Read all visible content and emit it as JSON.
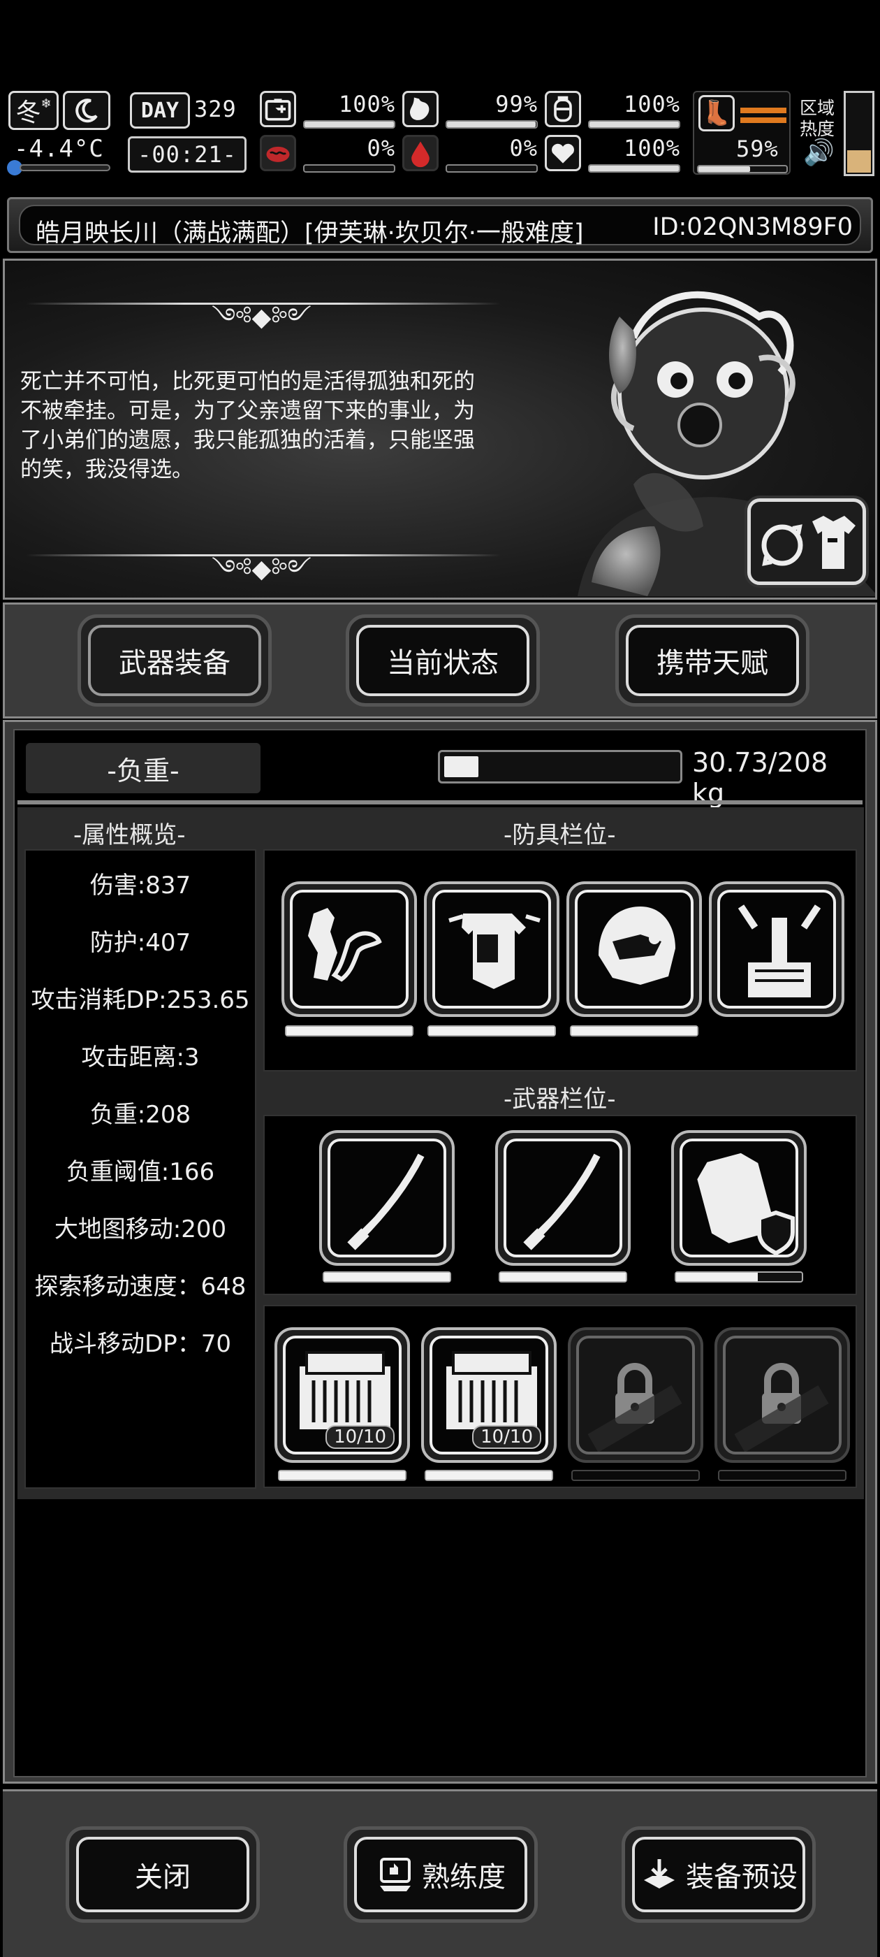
{
  "status": {
    "season": "冬",
    "temperature": "-4.4°C",
    "day_label": "DAY",
    "day": "329",
    "clock": "-00:21-",
    "meters": [
      {
        "icon": "medkit-icon",
        "value": "100%",
        "level": 1.0
      },
      {
        "icon": "stomach-icon",
        "value": "99%",
        "level": 0.99
      },
      {
        "icon": "water-bottle-icon",
        "value": "100%",
        "level": 1.0
      },
      {
        "icon": "brain-icon",
        "value": "0%",
        "level": 0.0
      },
      {
        "icon": "blood-drop-icon",
        "value": "0%",
        "level": 0.0
      },
      {
        "icon": "heart-icon",
        "value": "100%",
        "level": 1.0
      }
    ],
    "boot": {
      "value": "59%",
      "level": 0.59
    },
    "zone_label": "区域热度",
    "zone_level": 0.28
  },
  "title": {
    "name": "皓月映长川（满战满配）[伊芙琳·坎贝尔·一般难度]",
    "id": "ID:02QN3M89F0"
  },
  "hero": {
    "quote": "死亡并不可怕，比死更可怕的是活得孤独和死的不被牵挂。可是，为了父亲遗留下来的事业，为了小弟们的遗愿，我只能孤独的活着，只能坚强的笑，我没得选。"
  },
  "tabs": [
    "武器装备",
    "当前状态",
    "携带天赋"
  ],
  "load": {
    "label": "-负重-",
    "text": "30.73/208 kg",
    "level": 0.148
  },
  "attributes_header": "-属性概览-",
  "attributes": [
    "伤害:837",
    "防护:407",
    "攻击消耗DP:253.65",
    "攻击距离:3",
    "负重:208",
    "负重阈值:166",
    "大地图移动:200",
    "探索移动速度：648",
    "战斗移动DP：70"
  ],
  "armor_header": "-防具栏位-",
  "armor_slots": [
    {
      "icon": "arm-armor-icon",
      "durability": 1.0
    },
    {
      "icon": "chest-armor-icon",
      "durability": 1.0
    },
    {
      "icon": "helmet-icon",
      "durability": 1.0
    },
    {
      "icon": "backpack-frame-icon",
      "durability": null
    }
  ],
  "weapon_header": "-武器栏位-",
  "weapon_slots": [
    {
      "icon": "katana-icon",
      "durability": 1.0
    },
    {
      "icon": "katana-icon",
      "durability": 1.0
    },
    {
      "icon": "shield-pack-icon",
      "durability": 0.65
    }
  ],
  "item_slots": [
    {
      "icon": "ammo-box-icon",
      "count": "10/10",
      "durability": 1.0,
      "locked": false
    },
    {
      "icon": "ammo-box-icon",
      "count": "10/10",
      "durability": 1.0,
      "locked": false
    },
    {
      "icon": "lock-icon",
      "count": "",
      "durability": 0,
      "locked": true
    },
    {
      "icon": "lock-icon",
      "count": "",
      "durability": 0,
      "locked": true
    }
  ],
  "bottom": {
    "close": "关闭",
    "proficiency": "熟练度",
    "preset": "装备预设"
  }
}
